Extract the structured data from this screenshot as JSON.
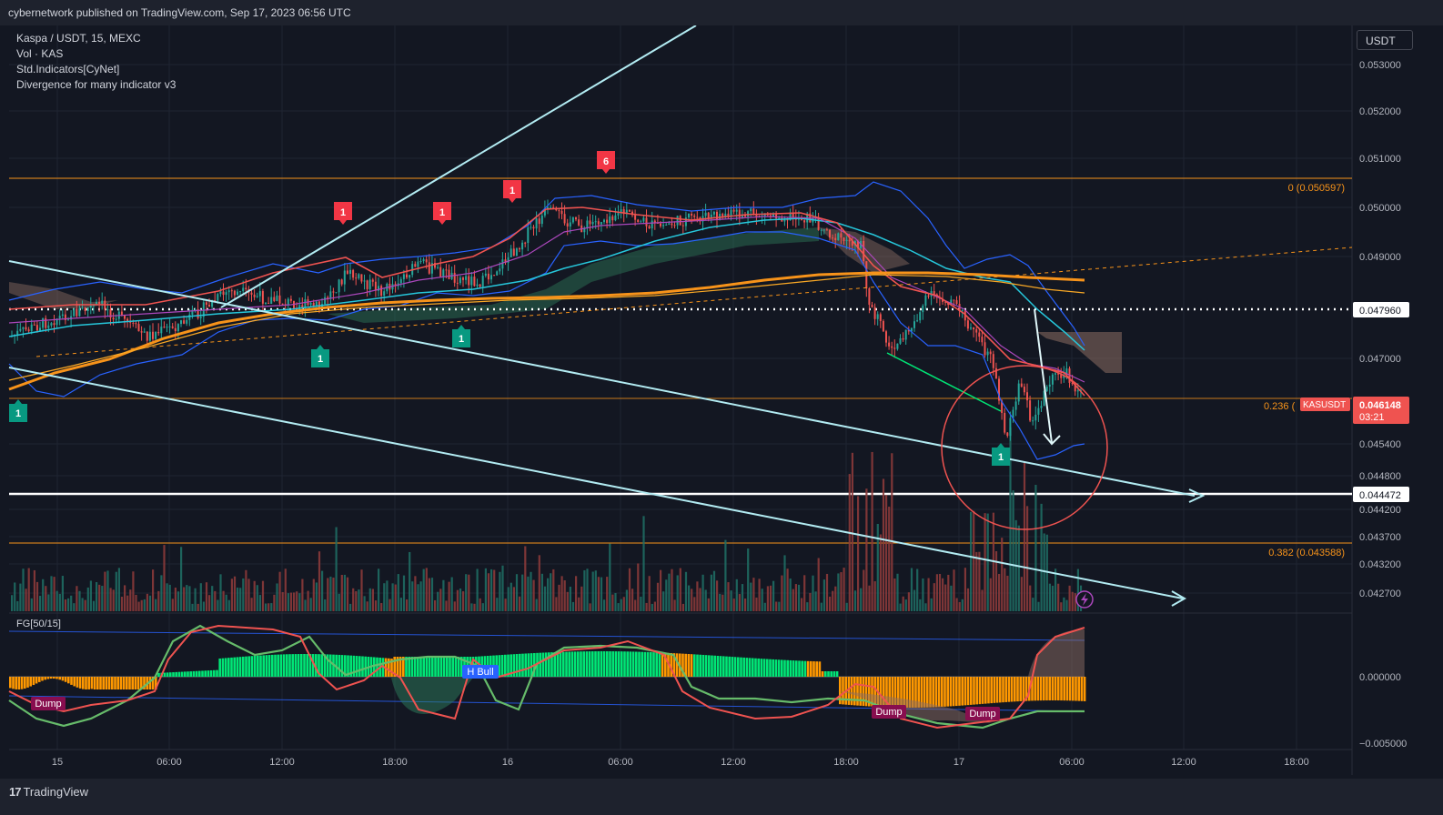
{
  "header": {
    "publisher_text": "cybernetwork published on TradingView.com, Sep 17, 2023 06:56 UTC"
  },
  "legend": {
    "symbol": "Kaspa / USDT, 15, MEXC",
    "volume": "Vol · KAS",
    "std_indicators": "Std.Indicators[CyNet]",
    "divergence": "Divergence for many indicator v3"
  },
  "toolbar": {
    "currency_label": "USDT"
  },
  "price_axis": {
    "ticks": [
      "0.053000",
      "0.052000",
      "0.051000",
      "0.050000",
      "0.049000",
      "0.047000",
      "0.045400",
      "0.044800",
      "0.044200",
      "0.043700",
      "0.043200",
      "0.042700"
    ],
    "highlight_white_1": "0.047960",
    "highlight_white_2": "0.044472",
    "current_price": "0.046148",
    "countdown": "03:21",
    "symbol_tag": "KASUSDT"
  },
  "fib_levels": {
    "level_0": "0 (0.050597)",
    "level_236": "0.236 (",
    "level_382": "0.382 (0.043588)"
  },
  "signals": {
    "sell_labels": [
      "1",
      "1",
      "1",
      "6"
    ],
    "buy_labels": [
      "1",
      "1",
      "1",
      "1"
    ]
  },
  "oscillator": {
    "title": "FG[50/15]",
    "ticks": [
      "0.000000",
      "−0.005000"
    ],
    "labels": {
      "dump": "Dump",
      "h_bull": "H Bull"
    }
  },
  "time_axis": {
    "ticks": [
      "15",
      "06:00",
      "12:00",
      "18:00",
      "16",
      "06:00",
      "12:00",
      "18:00",
      "17",
      "06:00",
      "12:00",
      "18:00"
    ]
  },
  "footer": {
    "brand": "TradingView",
    "brand_mark": "17"
  },
  "colors": {
    "background": "#131722",
    "up": "#26a69a",
    "down": "#ef5350",
    "fib": "#f7931a",
    "trendline": "#b2ebf2",
    "osc_green": "#00e676",
    "osc_orange": "#ff9800"
  }
}
